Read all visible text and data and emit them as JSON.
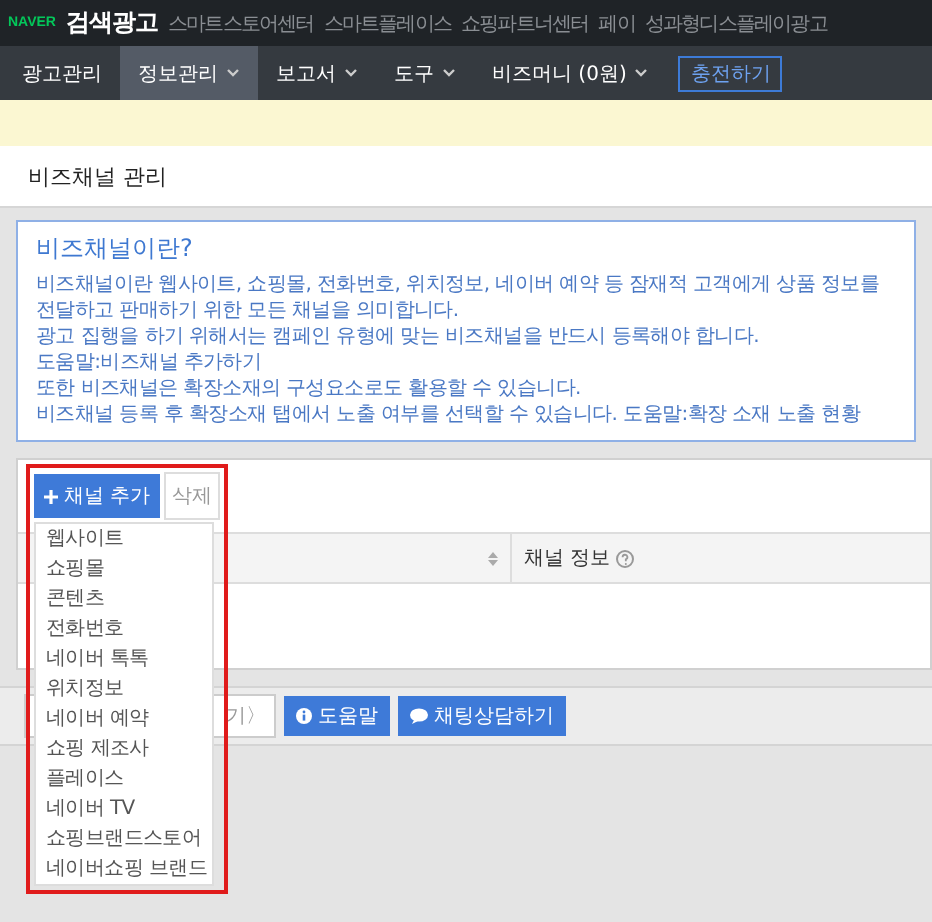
{
  "top_bar": {
    "logo": "NAVER",
    "product": "검색광고",
    "links": [
      "스마트스토어센터",
      "스마트플레이스",
      "쇼핑파트너센터",
      "페이",
      "성과형디스플레이광고"
    ]
  },
  "nav": {
    "items": [
      {
        "label": "광고관리",
        "selected": false,
        "dropdown": false
      },
      {
        "label": "정보관리",
        "selected": true,
        "dropdown": true
      },
      {
        "label": "보고서",
        "selected": false,
        "dropdown": true
      },
      {
        "label": "도구",
        "selected": false,
        "dropdown": true
      },
      {
        "label": "비즈머니 (0원)",
        "selected": false,
        "dropdown": true
      }
    ],
    "charge_button": "충전하기"
  },
  "page_title": "비즈채널 관리",
  "info": {
    "title": "비즈채널이란?",
    "lines": [
      {
        "text": "비즈채널이란 웹사이트, 쇼핑몰, 전화번호, 위치정보, 네이버 예약 등 잠재적 고객에게 상품 정보를 전달하고 판매하기 위한 모든 채널을 의미합니다."
      },
      {
        "text": "광고 집행을 하기 위해서는 캠페인 유형에 맞는 비즈채널을 반드시 등록해야 합니다.",
        "link": "도움말:비즈채널 추가하기"
      },
      {
        "text": "또한 비즈채널은 확장소재의 구성요소로도 활용할 수 있습니다."
      },
      {
        "text": "비즈채널 등록 후 확장소재 탭에서 노출 여부를 선택할 수 있습니다.",
        "link": "도움말:확장 소재 노출 현황"
      }
    ]
  },
  "panel": {
    "add_button": "채널 추가",
    "delete_button": "삭제",
    "add_menu": [
      "웹사이트",
      "쇼핑몰",
      "콘텐츠",
      "전화번호",
      "네이버 톡톡",
      "위치정보",
      "네이버 예약",
      "쇼핑 제조사",
      "플레이스",
      "네이버 TV",
      "쇼핑브랜드스토어",
      "네이버쇼핑 브랜드"
    ],
    "column_2_header": "채널 정보"
  },
  "footer": {
    "buttons": [
      {
        "kind": "partial",
        "label": "기〉"
      },
      {
        "kind": "help",
        "label": "도움말"
      },
      {
        "kind": "chat",
        "label": "채팅상담하기"
      }
    ]
  }
}
